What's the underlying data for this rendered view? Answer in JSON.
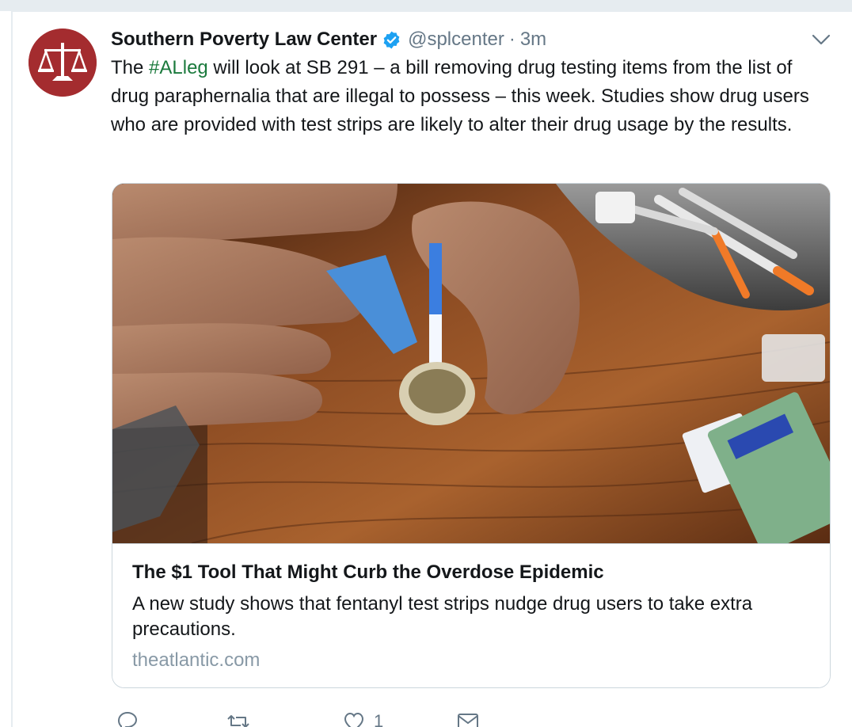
{
  "tweet": {
    "author_name": "Southern Poverty Law Center",
    "handle": "@splcenter",
    "separator": "·",
    "time": "3m",
    "text_before": "The ",
    "hashtag": "#ALleg",
    "text_after": " will look at SB 291 – a bill removing drug testing items from the list of drug paraphernalia that are illegal to possess – this week. Studies show drug users who are provided with test strips are likely to alter their drug usage by the results."
  },
  "card": {
    "title": "The $1 Tool That Might Curb the Overdose Epidemic",
    "description": "A new study shows that fentanyl test strips nudge drug users to take extra precautions.",
    "domain": "theatlantic.com"
  },
  "actions": {
    "like_count": "1"
  },
  "icons": {
    "avatar": "scales-of-justice-logo",
    "verified": "verified-badge-icon",
    "caret": "chevron-down-icon",
    "reply": "reply-icon",
    "retweet": "retweet-icon",
    "like": "heart-icon",
    "message": "envelope-icon"
  },
  "colors": {
    "hashtag": "#1b7a3d",
    "verified": "#1da1f2",
    "avatar_bg": "#a42c2f",
    "secondary_text": "#657786",
    "domain_text": "#8899a6"
  }
}
